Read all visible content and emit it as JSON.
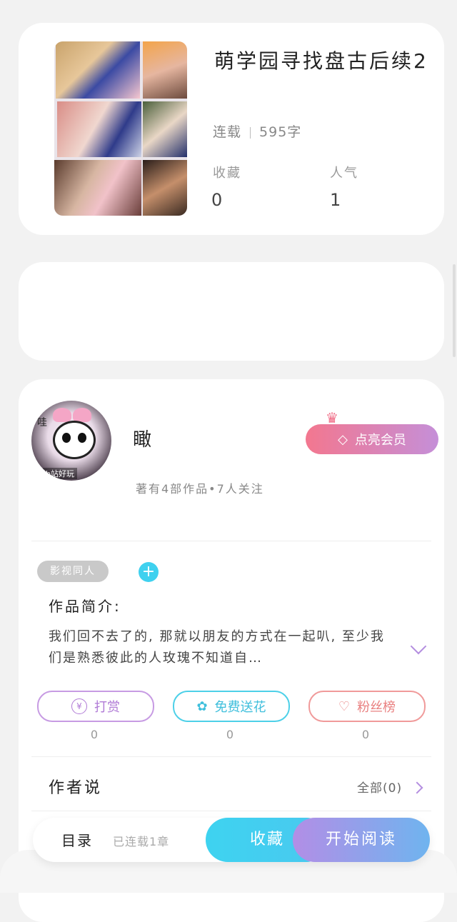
{
  "book": {
    "title": "萌学园寻找盘古后续2",
    "status": "连载",
    "word_count": "595字",
    "stats": [
      {
        "label": "收藏",
        "value": "0"
      },
      {
        "label": "人气",
        "value": "1"
      }
    ]
  },
  "author": {
    "name": "瞰",
    "info": "著有4部作品•7人关注",
    "avatar_text": "哇",
    "avatar_caption": "b站好玩",
    "vip_label": "点亮会员"
  },
  "tags": [
    "影视同人"
  ],
  "intro": {
    "title": "作品简介:",
    "text": "我们回不去了的, 那就以朋友的方式在一起叭, 至少我们是熟悉彼此的人玫瑰不知道自…"
  },
  "actions": [
    {
      "label": "打赏",
      "count": "0",
      "icon": "yen-icon"
    },
    {
      "label": "免费送花",
      "count": "0",
      "icon": "flower-icon"
    },
    {
      "label": "粉丝榜",
      "count": "0",
      "icon": "user-heart-icon"
    }
  ],
  "author_says": {
    "title": "作者说",
    "link": "全部(0)"
  },
  "bottom_bar": {
    "toc": "目录",
    "toc_status": "已连载1章",
    "collect": "收藏",
    "read": "开始阅读"
  },
  "colors": {
    "accent_cyan": "#3ed3f0",
    "accent_purple": "#b28ee6",
    "vip_pink": "#f3778f"
  }
}
